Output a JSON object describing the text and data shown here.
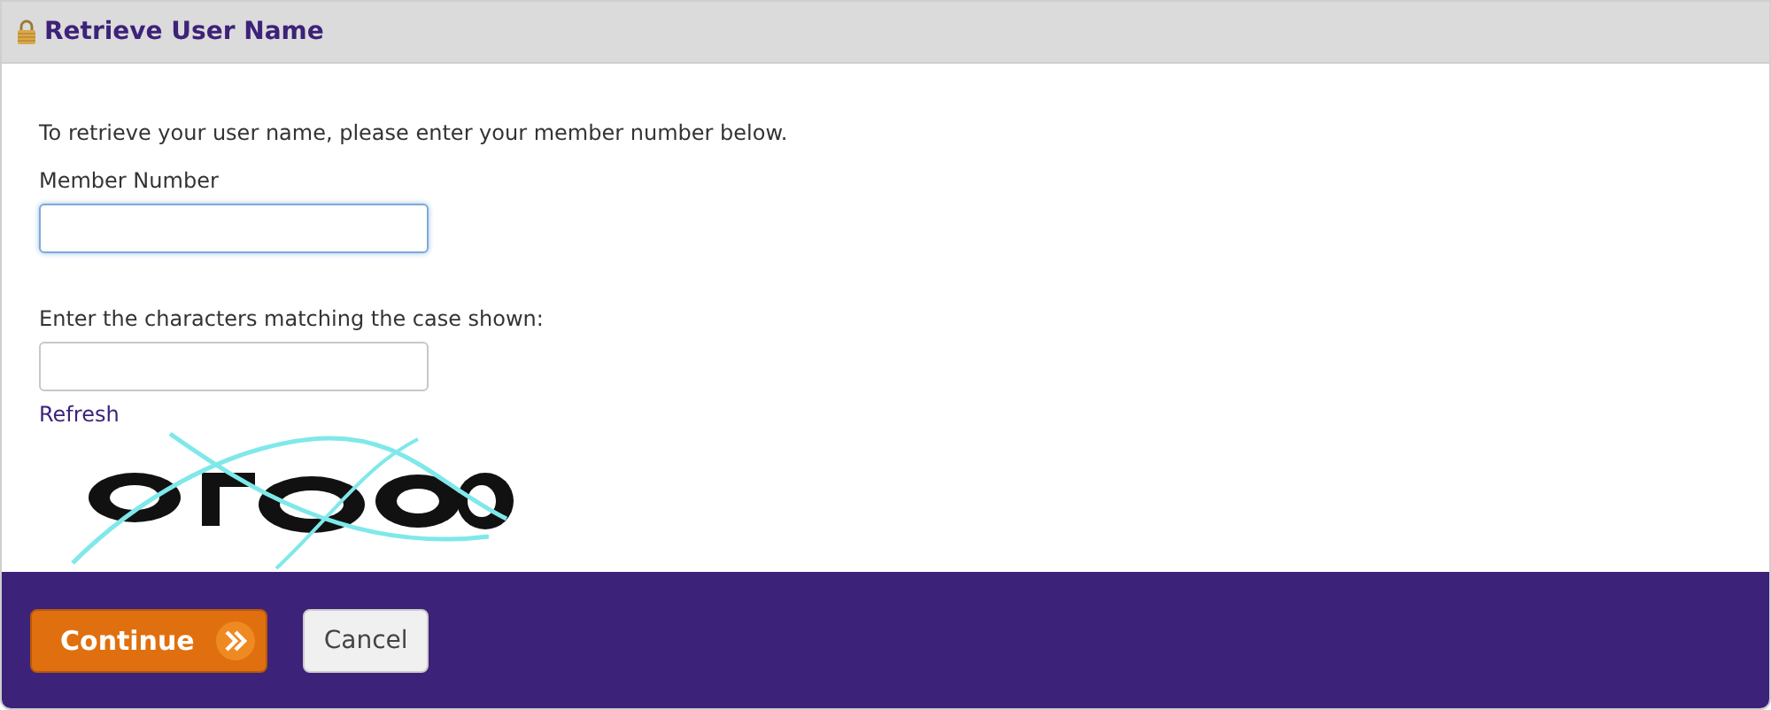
{
  "header": {
    "title": "Retrieve User Name"
  },
  "intro": "To retrieve your user name, please enter your member number below.",
  "fields": [
    {
      "label": "Member Number",
      "focused": true
    },
    {
      "label": "Enter the characters matching the case shown:",
      "focused": false
    }
  ],
  "refresh_link": "Refresh",
  "buttons": [
    {
      "label": "Continue",
      "kind": "primary"
    },
    {
      "label": "Cancel",
      "kind": "secondary"
    }
  ]
}
